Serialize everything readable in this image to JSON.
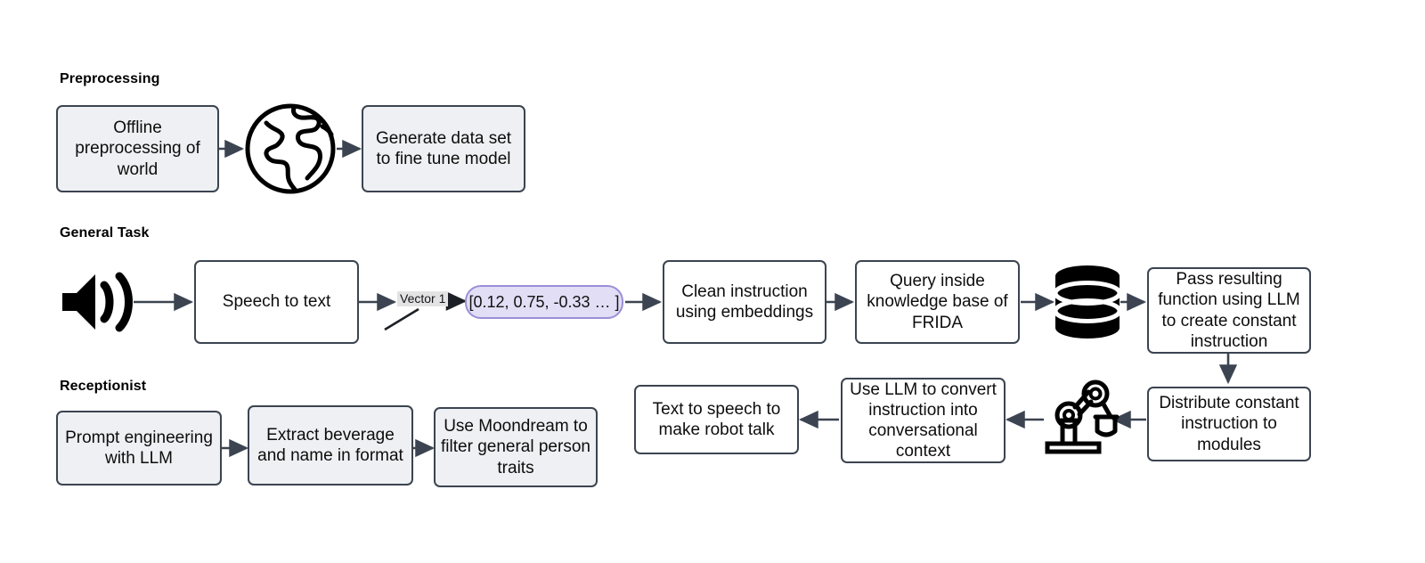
{
  "diagram": {
    "title_hidden": "",
    "background_color": "#ffffff",
    "box_border_color": "#3b4450",
    "box_fill_gray": "#eef0f3",
    "box_fill_white": "#ffffff",
    "arrow_color": "#3b4450",
    "vector_chip_fill": "#e1def5",
    "vector_chip_border": "#9a8fd8",
    "edge_label_fill": "#e3e3e3",
    "icon_color": "#000000"
  },
  "sections": [
    {
      "id": "preprocessing",
      "label": "Preprocessing"
    },
    {
      "id": "general-task",
      "label": "General Task"
    },
    {
      "id": "receptionist",
      "label": "Receptionist"
    }
  ],
  "preprocessing": {
    "nodes": [
      {
        "id": "offline-preprocessing",
        "label": "Offline preprocessing of world"
      },
      {
        "id": "generate-data-set",
        "label": "Generate data set to fine tune model"
      }
    ],
    "icons": [
      {
        "id": "globe",
        "name": "globe-icon"
      }
    ]
  },
  "general_task": {
    "icons": [
      {
        "id": "speaker",
        "name": "speaker-icon"
      },
      {
        "id": "database",
        "name": "database-icon"
      }
    ],
    "nodes": [
      {
        "id": "speech-to-text",
        "label": "Speech to text"
      },
      {
        "id": "clean-instruction",
        "label": "Clean instruction using embeddings"
      },
      {
        "id": "query-knowledge-base",
        "label": "Query inside knowledge base of FRIDA"
      },
      {
        "id": "pass-resulting-function",
        "label": "Pass resulting function using LLM to create constant instruction"
      },
      {
        "id": "distribute-constant-instruction",
        "label": "Distribute constant instruction to modules"
      }
    ],
    "edge_label": "Vector 1",
    "vector_value": "[0.12, 0.75, -0.33 … ]"
  },
  "receptionist": {
    "nodes": [
      {
        "id": "prompt-engineering",
        "label": "Prompt engineering with LLM"
      },
      {
        "id": "extract-beverage",
        "label": "Extract beverage and name in format"
      },
      {
        "id": "use-moondream",
        "label": "Use Moondream to filter general person traits"
      },
      {
        "id": "text-to-speech",
        "label": "Text to speech to make robot talk"
      },
      {
        "id": "use-llm-convert",
        "label": "Use LLM to convert instruction into conversational context"
      }
    ],
    "icons": [
      {
        "id": "robot-arm",
        "name": "robot-arm-icon"
      }
    ]
  }
}
